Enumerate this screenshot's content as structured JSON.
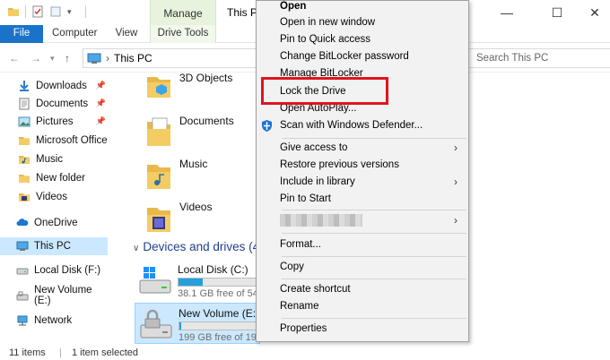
{
  "window": {
    "title": "This P",
    "contextual_tab_group": "Manage"
  },
  "ribbon": {
    "tabs": [
      {
        "label": "File"
      },
      {
        "label": "Computer"
      },
      {
        "label": "View"
      },
      {
        "label": "Drive Tools"
      }
    ]
  },
  "address": {
    "location": "This PC",
    "search_placeholder": "Search This PC"
  },
  "nav_pane": {
    "items": [
      {
        "label": "Downloads",
        "pinned": true
      },
      {
        "label": "Documents",
        "pinned": true
      },
      {
        "label": "Pictures",
        "pinned": true
      },
      {
        "label": "Microsoft Office"
      },
      {
        "label": "Music"
      },
      {
        "label": "New folder"
      },
      {
        "label": "Videos"
      },
      {
        "label": "OneDrive"
      },
      {
        "label": "This PC",
        "selected": true
      },
      {
        "label": "Local Disk (F:)"
      },
      {
        "label": "New Volume (E:)"
      },
      {
        "label": "Network"
      }
    ]
  },
  "content": {
    "folders": [
      {
        "label": "3D Objects"
      },
      {
        "label": "Documents"
      },
      {
        "label": "Music"
      },
      {
        "label": "Videos"
      }
    ],
    "devices_header": "Devices and drives (4)",
    "drives": [
      {
        "label": "Local Disk (C:)",
        "free_text": "38.1 GB free of 54",
        "usage_percent": 30
      },
      {
        "label": "New Volume (E:)",
        "free_text": "199 GB free of 199",
        "usage_percent": 2,
        "selected": true
      }
    ]
  },
  "status": {
    "items_count": "11 items",
    "selected_count": "1 item selected"
  },
  "context_menu": {
    "items": [
      {
        "label": "Open",
        "bold": true
      },
      {
        "label": "Open in new window"
      },
      {
        "label": "Pin to Quick access"
      },
      {
        "label": "Change BitLocker password"
      },
      {
        "label": "Manage BitLocker"
      },
      {
        "label": "Lock the Drive",
        "highlighted": true
      },
      {
        "label": "Open AutoPlay..."
      },
      {
        "label": "Scan with Windows Defender...",
        "icon": "windows-defender-shield-icon"
      },
      {
        "label": "Give access to",
        "submenu": true
      },
      {
        "label": "Restore previous versions"
      },
      {
        "label": "Include in library",
        "submenu": true
      },
      {
        "label": "Pin to Start"
      },
      {
        "label": "Format..."
      },
      {
        "label": "Copy"
      },
      {
        "label": "Create shortcut"
      },
      {
        "label": "Rename"
      },
      {
        "label": "Properties"
      }
    ]
  },
  "colors": {
    "accent": "#1a73c9",
    "selection": "#cce8ff",
    "highlight_box": "#e0141e",
    "drive_bar": "#26a0da"
  }
}
